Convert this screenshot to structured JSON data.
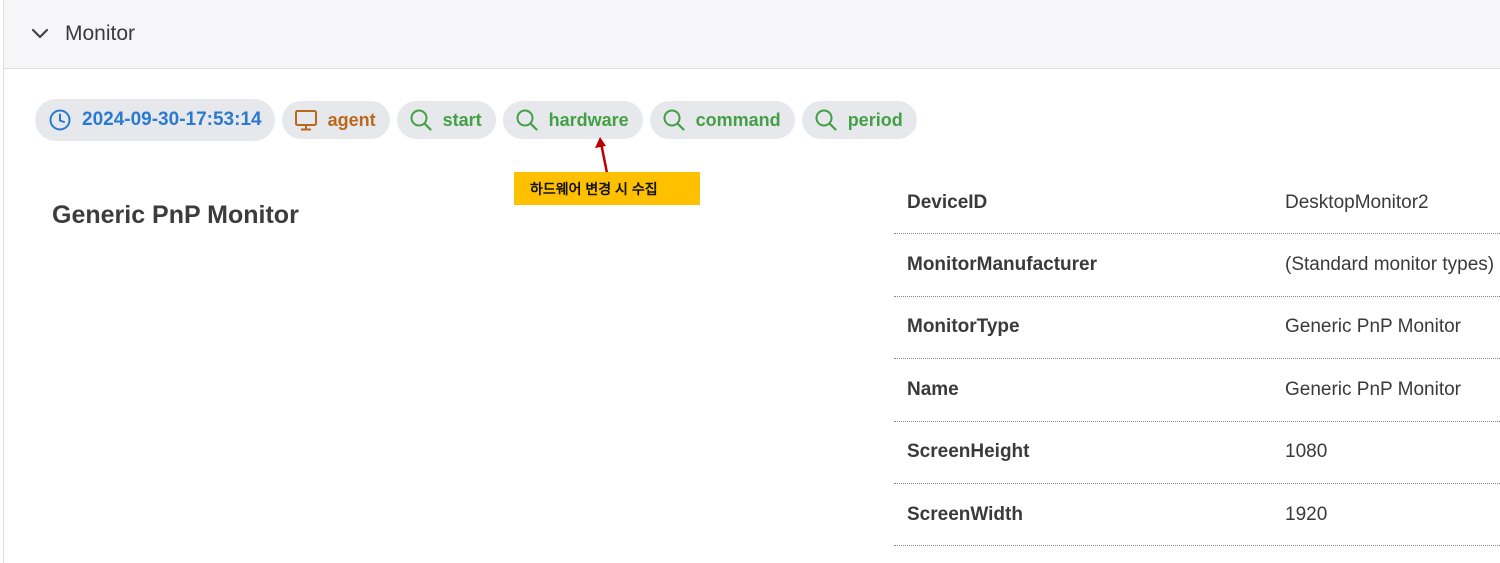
{
  "section": {
    "title": "Monitor",
    "collapse_icon": "chevron-down-icon"
  },
  "tags": {
    "timestamp": "2024-09-30-17:53:14",
    "agent": "agent",
    "start": "start",
    "hardware": "hardware",
    "command": "command",
    "period": "period"
  },
  "annotation": {
    "text": "하드웨어 변경 시 수집",
    "color": "#ffc000",
    "arrow_color": "#c00000"
  },
  "device": {
    "title": "Generic PnP Monitor"
  },
  "properties": [
    {
      "key": "DeviceID",
      "value": "DesktopMonitor2"
    },
    {
      "key": "MonitorManufacturer",
      "value": "(Standard monitor types)"
    },
    {
      "key": "MonitorType",
      "value": "Generic PnP Monitor"
    },
    {
      "key": "Name",
      "value": "Generic PnP Monitor"
    },
    {
      "key": "ScreenHeight",
      "value": "1080"
    },
    {
      "key": "ScreenWidth",
      "value": "1920"
    }
  ],
  "colors": {
    "timestamp": "#2a7bd0",
    "agent": "#b8691d",
    "query": "#43a047"
  }
}
